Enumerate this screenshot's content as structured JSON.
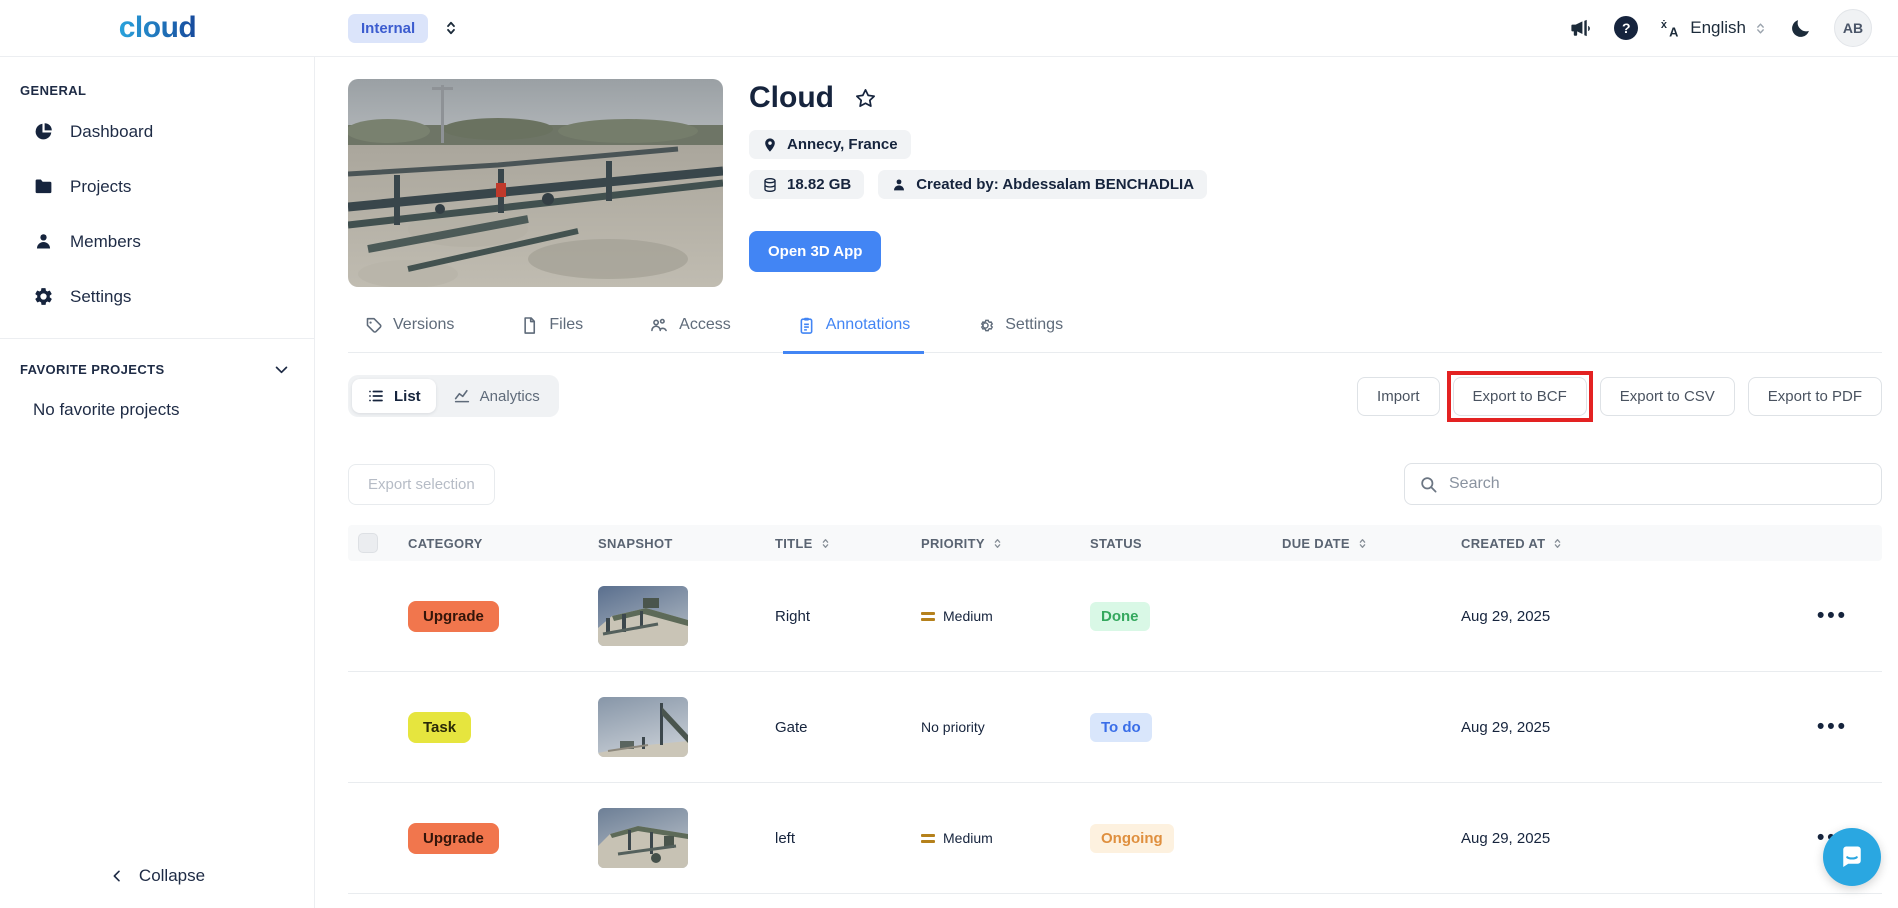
{
  "topbar": {
    "logo": "cloud",
    "workspace": {
      "label": "Internal"
    },
    "language": {
      "label": "English"
    },
    "avatar": "AB",
    "help_glyph": "?"
  },
  "sidebar": {
    "general_label": "GENERAL",
    "items": [
      {
        "label": "Dashboard",
        "icon": "pie-chart-icon"
      },
      {
        "label": "Projects",
        "icon": "folder-icon"
      },
      {
        "label": "Members",
        "icon": "person-icon"
      },
      {
        "label": "Settings",
        "icon": "gear-icon"
      }
    ],
    "favorites_label": "FAVORITE PROJECTS",
    "favorites_empty": "No favorite projects",
    "collapse_label": "Collapse"
  },
  "project": {
    "title": "Cloud",
    "location": "Annecy, France",
    "size": "18.82 GB",
    "created_by": "Created by: Abdessalam BENCHADLIA",
    "open_button": "Open 3D App"
  },
  "tabs": [
    {
      "label": "Versions",
      "icon": "tag-icon",
      "active": false
    },
    {
      "label": "Files",
      "icon": "file-icon",
      "active": false
    },
    {
      "label": "Access",
      "icon": "people-icon",
      "active": false
    },
    {
      "label": "Annotations",
      "icon": "clipboard-icon",
      "active": true
    },
    {
      "label": "Settings",
      "icon": "gear-icon",
      "active": false
    }
  ],
  "toolbar": {
    "view_toggle": {
      "list_label": "List",
      "analytics_label": "Analytics",
      "active": "List"
    },
    "import_label": "Import",
    "export_bcf_label": "Export to BCF",
    "export_csv_label": "Export to CSV",
    "export_pdf_label": "Export to PDF",
    "highlighted_button": "Export to BCF",
    "highlight_color": "#e32222"
  },
  "annotations_table": {
    "export_selection_label": "Export selection",
    "search_placeholder": "Search",
    "columns": [
      {
        "label": "CATEGORY",
        "sortable": false
      },
      {
        "label": "SNAPSHOT",
        "sortable": false
      },
      {
        "label": "TITLE",
        "sortable": true
      },
      {
        "label": "PRIORITY",
        "sortable": true
      },
      {
        "label": "STATUS",
        "sortable": false
      },
      {
        "label": "DUE DATE",
        "sortable": true
      },
      {
        "label": "CREATED AT",
        "sortable": true
      }
    ],
    "rows": [
      {
        "category": "Upgrade",
        "category_color": "#f1764d",
        "title": "Right",
        "priority": "Medium",
        "status": "Done",
        "status_bg": "#d9f8e6",
        "status_color": "#34a85e",
        "due_date": "",
        "created_at": "Aug 29, 2025"
      },
      {
        "category": "Task",
        "category_color": "#e6e53e",
        "title": "Gate",
        "priority": "No priority",
        "status": "To do",
        "status_bg": "#d9e6fb",
        "status_color": "#3a6ee8",
        "due_date": "",
        "created_at": "Aug 29, 2025"
      },
      {
        "category": "Upgrade",
        "category_color": "#f1764d",
        "title": "left",
        "priority": "Medium",
        "status": "Ongoing",
        "status_bg": "#fdf1df",
        "status_color": "#df8f3e",
        "due_date": "",
        "created_at": "Aug 29, 2025"
      }
    ]
  },
  "colors": {
    "accent_blue": "#4285f4",
    "priority_medium_icon": "#b5811c",
    "chat_bubble": "#2aa7e1"
  }
}
